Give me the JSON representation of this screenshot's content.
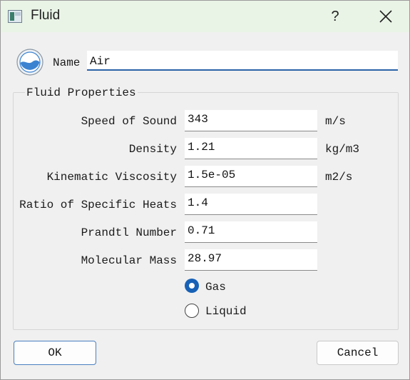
{
  "window": {
    "title": "Fluid",
    "help_label": "?",
    "close_icon": "close-icon"
  },
  "name": {
    "label": "Name",
    "value": "Air",
    "icon": "fluid-drop-icon"
  },
  "group": {
    "title": "Fluid Properties"
  },
  "properties": [
    {
      "label": "Speed of Sound",
      "value": "343",
      "unit": "m/s"
    },
    {
      "label": "Density",
      "value": "1.21",
      "unit": "kg/m3"
    },
    {
      "label": "Kinematic Viscosity",
      "value": "1.5e-05",
      "unit": "m2/s"
    },
    {
      "label": "Ratio of Specific Heats",
      "value": "1.4",
      "unit": ""
    },
    {
      "label": "Prandtl Number",
      "value": "0.71",
      "unit": ""
    },
    {
      "label": "Molecular Mass",
      "value": "28.97",
      "unit": ""
    }
  ],
  "phase": {
    "options": [
      {
        "label": "Gas",
        "selected": true
      },
      {
        "label": "Liquid",
        "selected": false
      }
    ]
  },
  "buttons": {
    "ok": "OK",
    "cancel": "Cancel"
  },
  "colors": {
    "accent": "#1761b6",
    "titlebar": "#e9f4e6"
  }
}
